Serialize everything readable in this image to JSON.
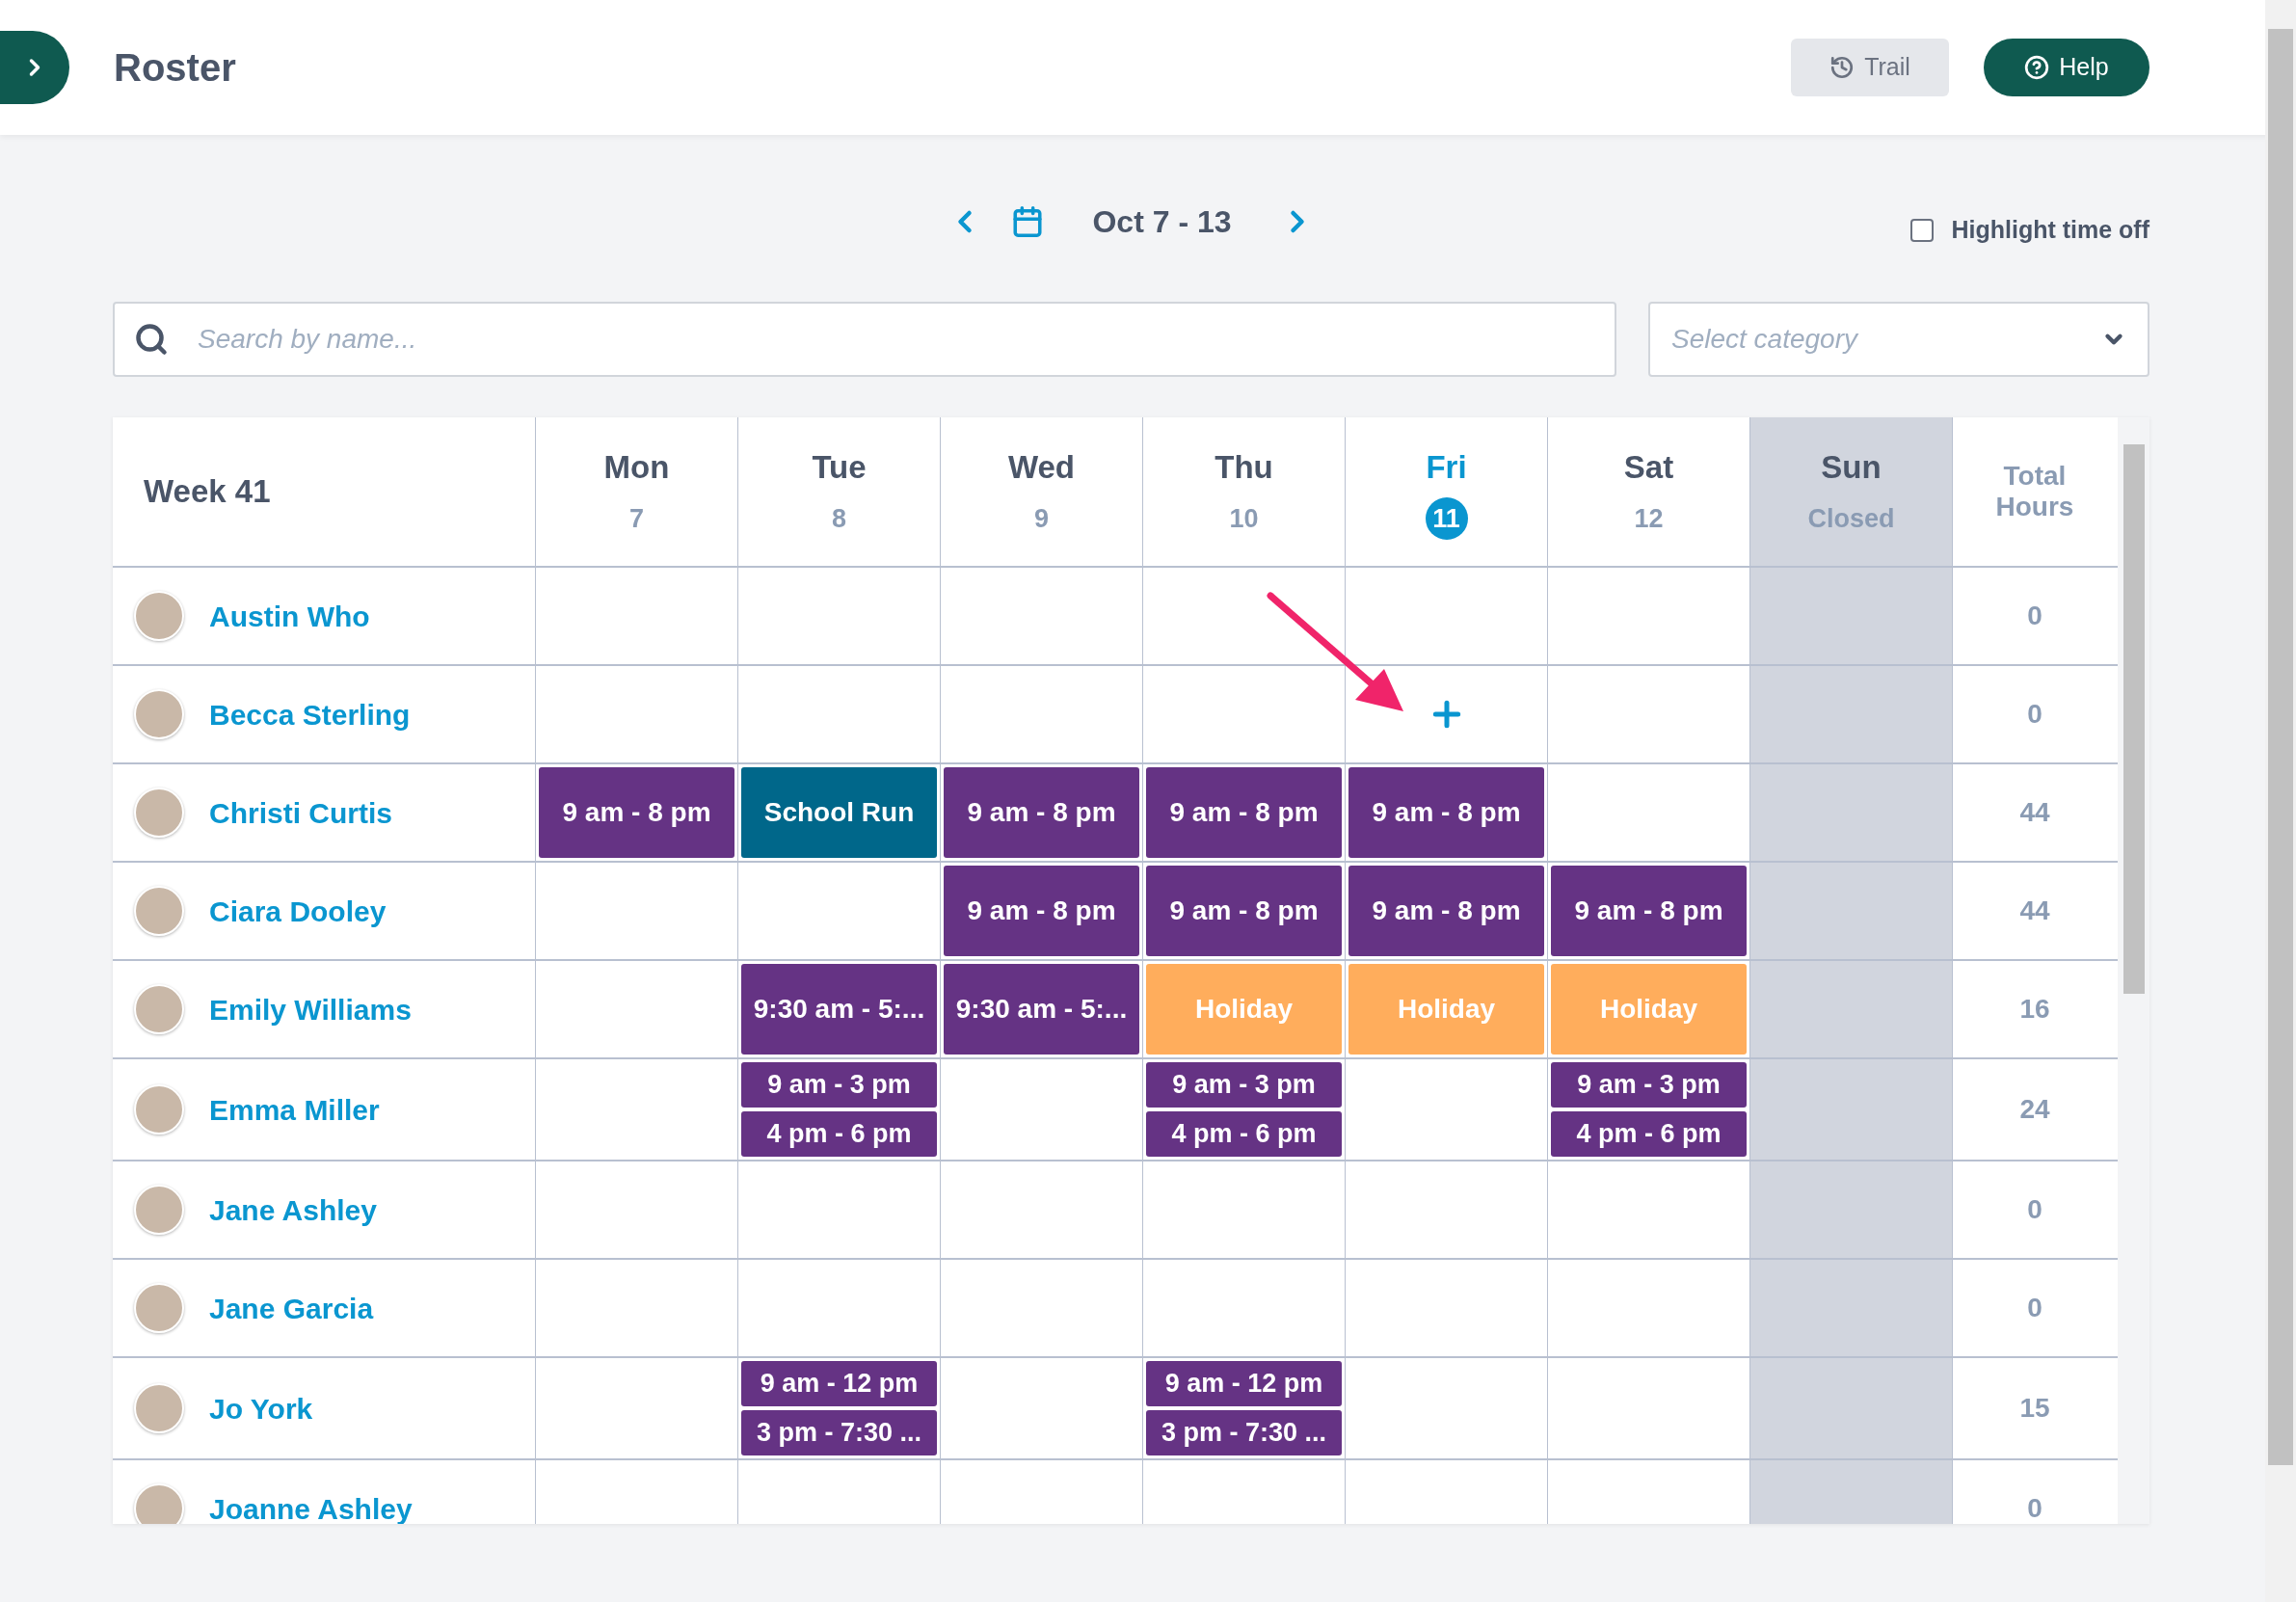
{
  "header": {
    "title": "Roster",
    "trail_button": "Trail",
    "help_button": "Help"
  },
  "week_nav": {
    "range": "Oct 7 - 13"
  },
  "highlight_time_off": {
    "label": "Highlight time off",
    "checked": false
  },
  "search": {
    "placeholder": "Search by name..."
  },
  "category_select": {
    "placeholder": "Select category"
  },
  "table": {
    "week_label": "Week 41",
    "total_label": "Total Hours",
    "days": [
      {
        "name": "Mon",
        "date": "7",
        "selected": false,
        "closed": false
      },
      {
        "name": "Tue",
        "date": "8",
        "selected": false,
        "closed": false
      },
      {
        "name": "Wed",
        "date": "9",
        "selected": false,
        "closed": false
      },
      {
        "name": "Thu",
        "date": "10",
        "selected": false,
        "closed": false
      },
      {
        "name": "Fri",
        "date": "11",
        "selected": true,
        "closed": false
      },
      {
        "name": "Sat",
        "date": "12",
        "selected": false,
        "closed": false
      },
      {
        "name": "Sun",
        "date": "Closed",
        "selected": false,
        "closed": true
      }
    ],
    "rows": [
      {
        "name": "Austin Who",
        "total": "0",
        "cells": [
          [],
          [],
          [],
          [],
          [],
          [],
          []
        ]
      },
      {
        "name": "Becca Sterling",
        "total": "0",
        "cells": [
          [],
          [],
          [],
          [],
          [
            {
              "kind": "add"
            }
          ],
          [],
          []
        ]
      },
      {
        "name": "Christi Curtis",
        "total": "44",
        "cells": [
          [
            {
              "kind": "shift",
              "text": "9 am - 8 pm"
            }
          ],
          [
            {
              "kind": "task",
              "text": "School Run"
            }
          ],
          [
            {
              "kind": "shift",
              "text": "9 am - 8 pm"
            }
          ],
          [
            {
              "kind": "shift",
              "text": "9 am - 8 pm"
            }
          ],
          [
            {
              "kind": "shift",
              "text": "9 am - 8 pm"
            }
          ],
          [],
          []
        ]
      },
      {
        "name": "Ciara Dooley",
        "total": "44",
        "cells": [
          [],
          [],
          [
            {
              "kind": "shift",
              "text": "9 am - 8 pm"
            }
          ],
          [
            {
              "kind": "shift",
              "text": "9 am - 8 pm"
            }
          ],
          [
            {
              "kind": "shift",
              "text": "9 am - 8 pm"
            }
          ],
          [
            {
              "kind": "shift",
              "text": "9 am - 8 pm"
            }
          ],
          []
        ]
      },
      {
        "name": "Emily Williams",
        "total": "16",
        "cells": [
          [],
          [
            {
              "kind": "shift",
              "text": "9:30 am - 5:..."
            }
          ],
          [
            {
              "kind": "shift",
              "text": "9:30 am - 5:..."
            }
          ],
          [
            {
              "kind": "holiday",
              "text": "Holiday"
            }
          ],
          [
            {
              "kind": "holiday",
              "text": "Holiday"
            }
          ],
          [
            {
              "kind": "holiday",
              "text": "Holiday"
            }
          ],
          []
        ]
      },
      {
        "name": "Emma Miller",
        "total": "24",
        "cells": [
          [],
          [
            {
              "kind": "shift",
              "text": "9 am - 3 pm"
            },
            {
              "kind": "shift",
              "text": "4 pm - 6 pm"
            }
          ],
          [],
          [
            {
              "kind": "shift",
              "text": "9 am - 3 pm"
            },
            {
              "kind": "shift",
              "text": "4 pm - 6 pm"
            }
          ],
          [],
          [
            {
              "kind": "shift",
              "text": "9 am - 3 pm"
            },
            {
              "kind": "shift",
              "text": "4 pm - 6 pm"
            }
          ],
          []
        ]
      },
      {
        "name": "Jane Ashley",
        "total": "0",
        "cells": [
          [],
          [],
          [],
          [],
          [],
          [],
          []
        ]
      },
      {
        "name": "Jane Garcia",
        "total": "0",
        "cells": [
          [],
          [],
          [],
          [],
          [],
          [],
          []
        ]
      },
      {
        "name": "Jo York",
        "total": "15",
        "cells": [
          [],
          [
            {
              "kind": "shift",
              "text": "9 am - 12 pm"
            },
            {
              "kind": "shift",
              "text": "3 pm - 7:30 ..."
            }
          ],
          [],
          [
            {
              "kind": "shift",
              "text": "9 am - 12 pm"
            },
            {
              "kind": "shift",
              "text": "3 pm - 7:30 ..."
            }
          ],
          [],
          [],
          []
        ]
      },
      {
        "name": "Joanne Ashley",
        "total": "0",
        "cells": [
          [],
          [],
          [],
          [],
          [],
          [],
          []
        ]
      }
    ]
  }
}
